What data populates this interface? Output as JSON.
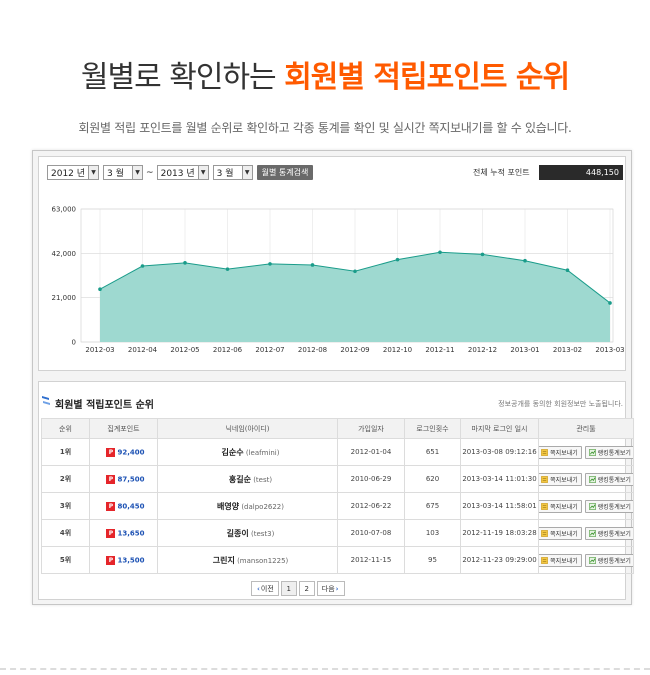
{
  "heading": {
    "prefix": "월별로 확인하는 ",
    "highlight": "회원별 적립포인트 순위"
  },
  "description": "회원별 적립 포인트를 월별 순위로 확인하고 각종 통계를 확인 및 실시간 쪽지보내기를 할 수 있습니다.",
  "filter": {
    "start_year": "2012 년",
    "start_month": "3 월",
    "tilde": "~",
    "end_year": "2013 년",
    "end_month": "3 월",
    "search_button": "월별 통계검색"
  },
  "total": {
    "label": "전체 누적 포인트",
    "value": "448,150"
  },
  "chart_data": {
    "type": "area",
    "categories": [
      "2012-03",
      "2012-04",
      "2012-05",
      "2012-06",
      "2012-07",
      "2012-08",
      "2012-09",
      "2012-10",
      "2012-11",
      "2012-12",
      "2013-01",
      "2013-02",
      "2013-03"
    ],
    "values": [
      25000,
      36000,
      37500,
      34500,
      37000,
      36500,
      33500,
      39000,
      42500,
      41500,
      38500,
      34000,
      18500
    ],
    "yticks": [
      "0",
      "21,000",
      "42,000",
      "63,000"
    ],
    "ylim": [
      0,
      63000
    ],
    "fill_color": "#9ed9d0",
    "line_color": "#1a9c8a",
    "grid": true
  },
  "ranking": {
    "title": "회원별 적립포인트 순위",
    "note": "정보공개를 동의한 회원정보만 노출됩니다.",
    "columns": [
      "순위",
      "집계포인트",
      "닉네임(아이디)",
      "가입일자",
      "로그인횟수",
      "마지막 로그인 일시",
      "관리툴"
    ],
    "badge": "P",
    "rows": [
      {
        "rank": "1위",
        "points": "92,400",
        "nick": "김순수",
        "id": "(leafmini)",
        "joined": "2012-01-04",
        "logins": "651",
        "last": "2013-03-08 09:12:16"
      },
      {
        "rank": "2위",
        "points": "87,500",
        "nick": "홍길순",
        "id": "(test)",
        "joined": "2010-06-29",
        "logins": "620",
        "last": "2013-03-14 11:01:30"
      },
      {
        "rank": "3위",
        "points": "80,450",
        "nick": "배영양",
        "id": "(dalpo2622)",
        "joined": "2012-06-22",
        "logins": "675",
        "last": "2013-03-14 11:58:01"
      },
      {
        "rank": "4위",
        "points": "13,650",
        "nick": "길종이",
        "id": "(test3)",
        "joined": "2010-07-08",
        "logins": "103",
        "last": "2012-11-19 18:03:28"
      },
      {
        "rank": "5위",
        "points": "13,500",
        "nick": "그린지",
        "id": "(manson1225)",
        "joined": "2012-11-15",
        "logins": "95",
        "last": "2012-11-23 09:29:00"
      }
    ],
    "btn_msg": "쪽지보내기",
    "btn_stats": "랭킹통계보기"
  },
  "pagination": {
    "prev": "이전",
    "pages": [
      "1",
      "2"
    ],
    "next": "다음"
  },
  "colors": {
    "accent": "#ff5a00",
    "point_badge": "#e5252a",
    "point_value": "#1d52b4",
    "chart_fill": "#9ed9d0",
    "chart_line": "#1a9c8a"
  }
}
